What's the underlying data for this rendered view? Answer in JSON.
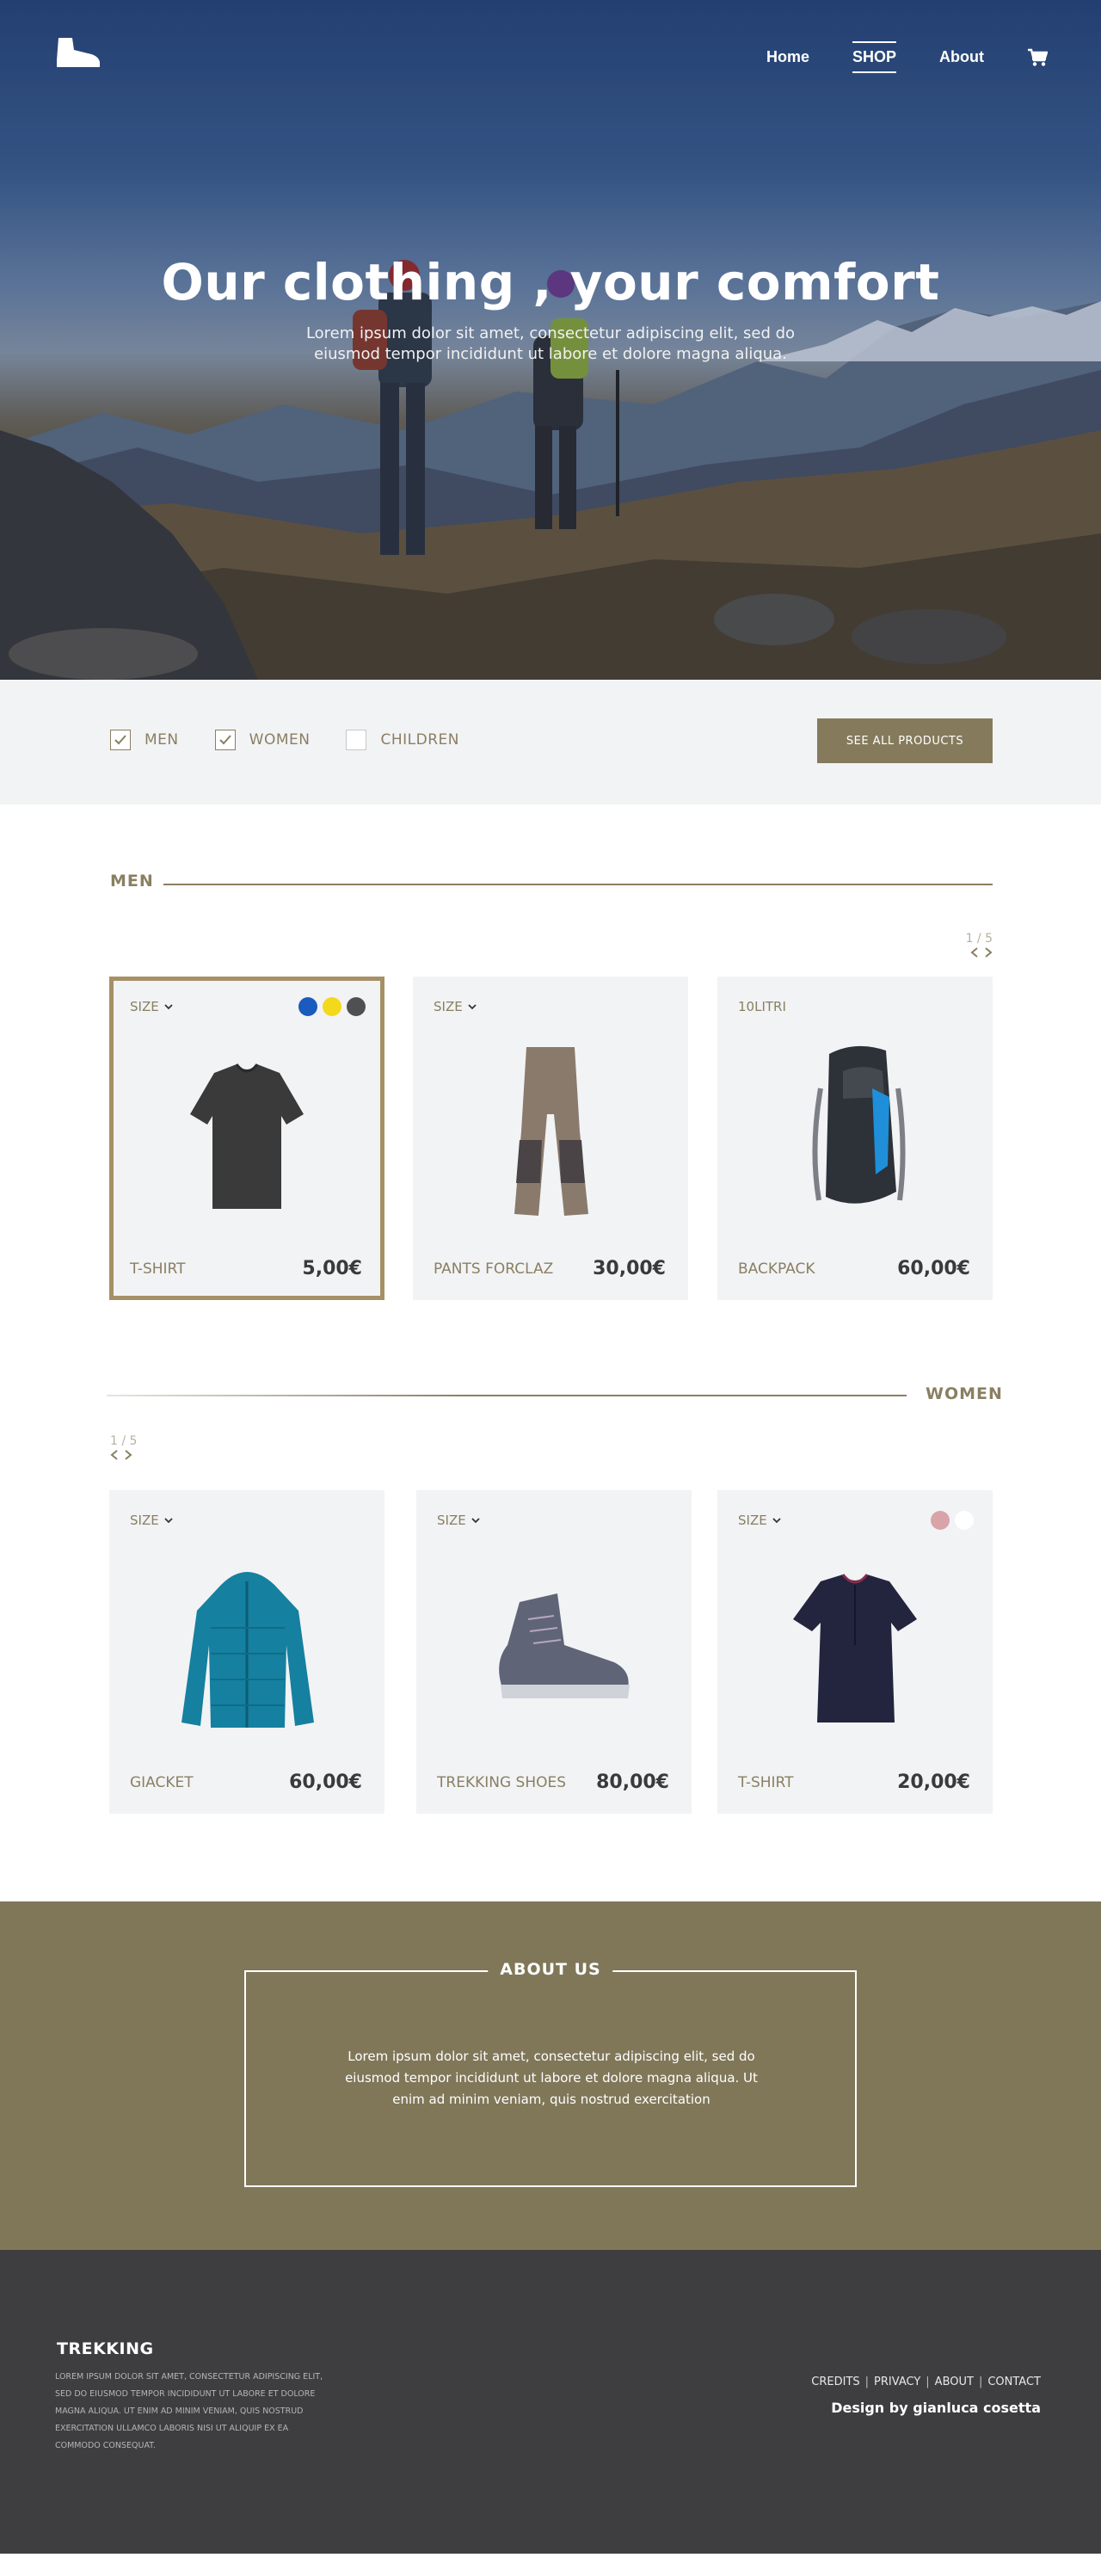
{
  "nav": {
    "home": "Home",
    "shop": "SHOP",
    "about": "About"
  },
  "hero": {
    "title": "Our clothing , your comfort",
    "subtitle": "Lorem ipsum dolor sit amet, consectetur adipiscing elit, sed do eiusmod tempor incididunt ut labore et dolore magna aliqua."
  },
  "filters": {
    "items": [
      {
        "label": "MEN",
        "checked": true
      },
      {
        "label": "WOMEN",
        "checked": true
      },
      {
        "label": "CHILDREN",
        "checked": false
      }
    ],
    "button": "SEE ALL PRODUCTS"
  },
  "men": {
    "title": "MEN",
    "pager": "1 / 5",
    "products": [
      {
        "selector": "SIZE",
        "name": "T-SHIRT",
        "price": "5,00€",
        "swatches": [
          "#1b5bbd",
          "#f4d81c",
          "#505050"
        ],
        "icon": "tshirt-icon"
      },
      {
        "selector": "SIZE",
        "name": "PANTS FORCLAZ",
        "price": "30,00€",
        "swatches": [],
        "icon": "pants-icon"
      },
      {
        "selector": "10LITRI",
        "name": "BACKPACK",
        "price": "60,00€",
        "swatches": [],
        "icon": "backpack-icon"
      }
    ]
  },
  "women": {
    "title": "WOMEN",
    "pager": "1 / 5",
    "products": [
      {
        "selector": "SIZE",
        "name": "GIACKET",
        "price": "60,00€",
        "swatches": [],
        "icon": "jacket-icon"
      },
      {
        "selector": "SIZE",
        "name": "TREKKING SHOES",
        "price": "80,00€",
        "swatches": [],
        "icon": "shoe-icon"
      },
      {
        "selector": "SIZE",
        "name": "T-SHIRT",
        "price": "20,00€",
        "swatches": [
          "#d9a3aa",
          "#ffffff"
        ],
        "icon": "women-tshirt-icon"
      }
    ]
  },
  "about": {
    "title": "ABOUT US",
    "text": "Lorem ipsum dolor sit amet, consectetur adipiscing elit, sed do eiusmod tempor incididunt ut labore et dolore magna aliqua. Ut enim ad minim veniam, quis nostrud exercitation"
  },
  "footer": {
    "brand": "TREKKING",
    "text": "LOREM IPSUM DOLOR SIT AMET, CONSECTETUR ADIPISCING ELIT, SED DO EIUSMOD TEMPOR INCIDIDUNT UT LABORE ET DOLORE MAGNA ALIQUA. UT ENIM AD MINIM VENIAM, QUIS NOSTRUD EXERCITATION ULLAMCO LABORIS NISI UT ALIQUIP EX EA COMMODO CONSEQUAT.",
    "links": [
      "CREDITS",
      "PRIVACY",
      "ABOUT",
      "CONTACT"
    ],
    "credit": "Design by gianluca cosetta"
  },
  "colors": {
    "accent": "#857b5c",
    "text": "#8a7f62",
    "card": "#f2f3f5",
    "footer": "#3e3e40"
  }
}
